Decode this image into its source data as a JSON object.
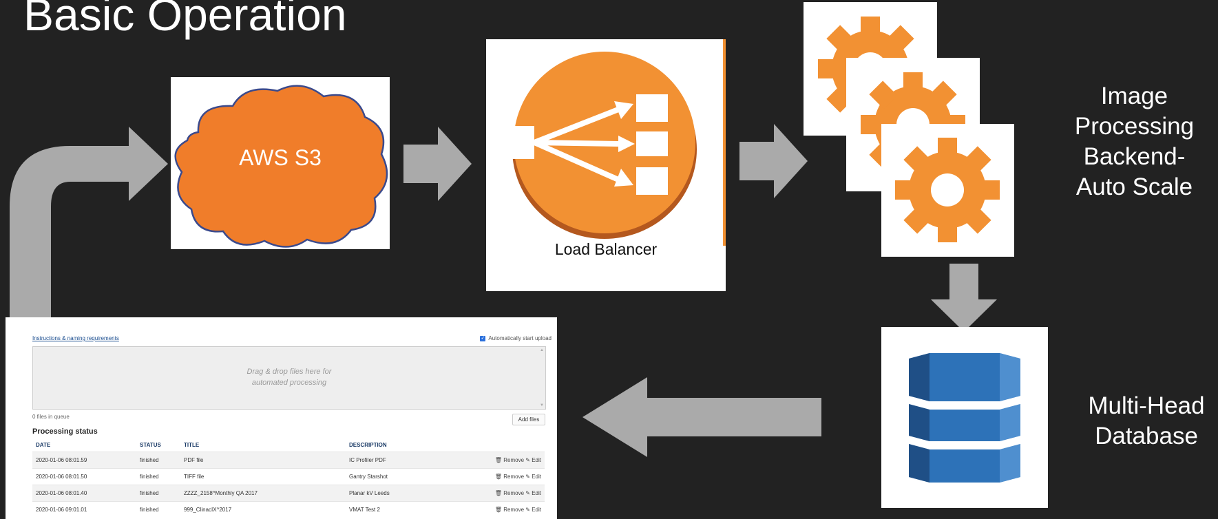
{
  "title": "Basic Operation",
  "s3": {
    "label": "AWS S3",
    "color": "#f07d2a"
  },
  "load_balancer": {
    "label": "Load Balancer",
    "color": "#f29133"
  },
  "processing": {
    "label_lines": [
      "Image",
      "Processing",
      "Backend-",
      "Auto Scale"
    ],
    "gear_color": "#f29133"
  },
  "database": {
    "label_lines": [
      "Multi-Head",
      "Database"
    ],
    "color": "#2d72b8"
  },
  "arrow_color": "#aaaaaa",
  "screenshot": {
    "instructions_link": "Instructions & naming requirements",
    "auto_start": "Automatically start upload",
    "auto_start_checked": true,
    "dropzone_lines": [
      "Drag & drop files here for",
      "automated processing"
    ],
    "queue_text": "0 files in queue",
    "add_files": "Add files",
    "section_title": "Processing status",
    "columns": [
      "DATE",
      "STATUS",
      "TITLE",
      "DESCRIPTION"
    ],
    "rows": [
      {
        "date": "2020-01-06 08:01.59",
        "status": "finished",
        "title": "PDF file",
        "description": "IC Profiler PDF"
      },
      {
        "date": "2020-01-06 08:01.50",
        "status": "finished",
        "title": "TIFF file",
        "description": "Gantry Starshot"
      },
      {
        "date": "2020-01-06 08:01.40",
        "status": "finished",
        "title": "ZZZZ_2158^Monthly QA 2017",
        "description": "Planar kV Leeds"
      },
      {
        "date": "2020-01-06 09:01.01",
        "status": "finished",
        "title": "999_ClinacIX^2017",
        "description": "VMAT Test 2"
      }
    ],
    "row_actions": {
      "remove": "Remove",
      "edit": "Edit"
    }
  }
}
